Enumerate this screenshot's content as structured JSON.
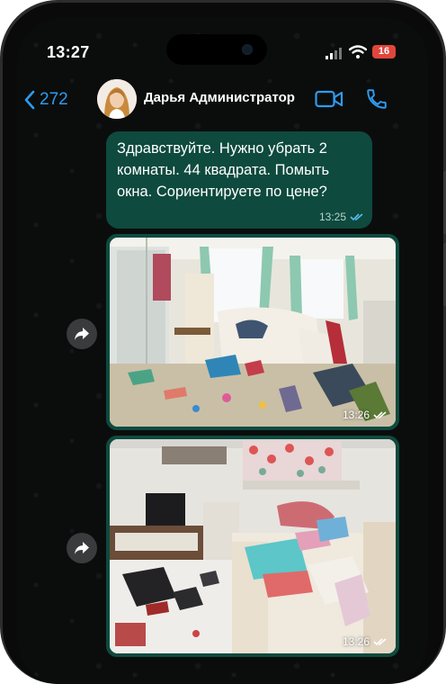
{
  "status": {
    "time": "13:27",
    "battery": "16"
  },
  "header": {
    "back_count": "272",
    "contact_name": "Дарья Администратор"
  },
  "messages": [
    {
      "type": "text",
      "text": "Здравствуйте. Нужно убрать 2 комнаты. 44 квадрата. Помыть окна. Сориентируете по цене?",
      "time": "13:25",
      "status": "read"
    },
    {
      "type": "photo",
      "time": "13:26",
      "status": "read"
    },
    {
      "type": "photo",
      "time": "13:26",
      "status": "read"
    }
  ],
  "colors": {
    "accent": "#2f9bf0",
    "bubble": "#0e4a3e",
    "battery": "#e0463c",
    "background": "#0b0d0c"
  }
}
